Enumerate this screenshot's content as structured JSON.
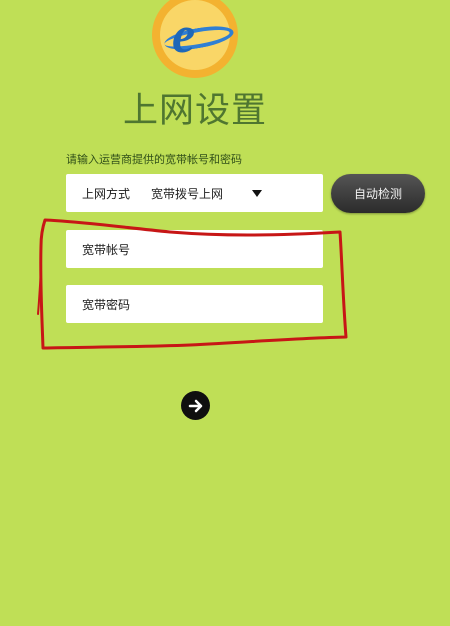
{
  "app": {
    "logo_letter": "e",
    "title": "上网设置",
    "instruction": "请输入运营商提供的宽带帐号和密码"
  },
  "form": {
    "dial_method_label": "上网方式",
    "dial_method_value": "宽带拨号上网",
    "account_placeholder": "宽带帐号",
    "password_placeholder": "宽带密码"
  },
  "actions": {
    "auto_detect_label": "自动检测",
    "next_icon": "arrow-right-icon"
  },
  "colors": {
    "background": "#bfdf56",
    "accent_title": "#4f7630",
    "annotation_red": "#c71616"
  }
}
